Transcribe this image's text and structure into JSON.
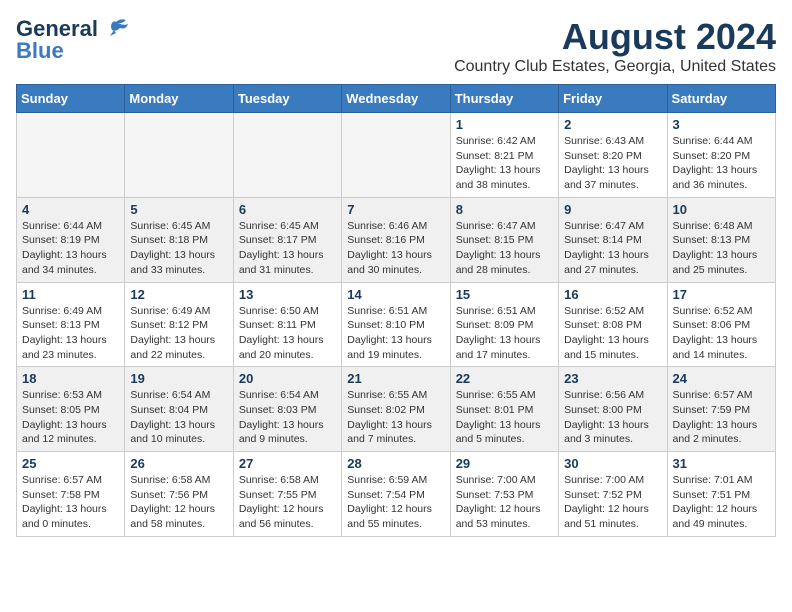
{
  "logo": {
    "line1": "General",
    "line2": "Blue"
  },
  "title": "August 2024",
  "subtitle": "Country Club Estates, Georgia, United States",
  "days_of_week": [
    "Sunday",
    "Monday",
    "Tuesday",
    "Wednesday",
    "Thursday",
    "Friday",
    "Saturday"
  ],
  "weeks": [
    [
      {
        "day": "",
        "info": ""
      },
      {
        "day": "",
        "info": ""
      },
      {
        "day": "",
        "info": ""
      },
      {
        "day": "",
        "info": ""
      },
      {
        "day": "1",
        "info": "Sunrise: 6:42 AM\nSunset: 8:21 PM\nDaylight: 13 hours\nand 38 minutes."
      },
      {
        "day": "2",
        "info": "Sunrise: 6:43 AM\nSunset: 8:20 PM\nDaylight: 13 hours\nand 37 minutes."
      },
      {
        "day": "3",
        "info": "Sunrise: 6:44 AM\nSunset: 8:20 PM\nDaylight: 13 hours\nand 36 minutes."
      }
    ],
    [
      {
        "day": "4",
        "info": "Sunrise: 6:44 AM\nSunset: 8:19 PM\nDaylight: 13 hours\nand 34 minutes."
      },
      {
        "day": "5",
        "info": "Sunrise: 6:45 AM\nSunset: 8:18 PM\nDaylight: 13 hours\nand 33 minutes."
      },
      {
        "day": "6",
        "info": "Sunrise: 6:45 AM\nSunset: 8:17 PM\nDaylight: 13 hours\nand 31 minutes."
      },
      {
        "day": "7",
        "info": "Sunrise: 6:46 AM\nSunset: 8:16 PM\nDaylight: 13 hours\nand 30 minutes."
      },
      {
        "day": "8",
        "info": "Sunrise: 6:47 AM\nSunset: 8:15 PM\nDaylight: 13 hours\nand 28 minutes."
      },
      {
        "day": "9",
        "info": "Sunrise: 6:47 AM\nSunset: 8:14 PM\nDaylight: 13 hours\nand 27 minutes."
      },
      {
        "day": "10",
        "info": "Sunrise: 6:48 AM\nSunset: 8:13 PM\nDaylight: 13 hours\nand 25 minutes."
      }
    ],
    [
      {
        "day": "11",
        "info": "Sunrise: 6:49 AM\nSunset: 8:13 PM\nDaylight: 13 hours\nand 23 minutes."
      },
      {
        "day": "12",
        "info": "Sunrise: 6:49 AM\nSunset: 8:12 PM\nDaylight: 13 hours\nand 22 minutes."
      },
      {
        "day": "13",
        "info": "Sunrise: 6:50 AM\nSunset: 8:11 PM\nDaylight: 13 hours\nand 20 minutes."
      },
      {
        "day": "14",
        "info": "Sunrise: 6:51 AM\nSunset: 8:10 PM\nDaylight: 13 hours\nand 19 minutes."
      },
      {
        "day": "15",
        "info": "Sunrise: 6:51 AM\nSunset: 8:09 PM\nDaylight: 13 hours\nand 17 minutes."
      },
      {
        "day": "16",
        "info": "Sunrise: 6:52 AM\nSunset: 8:08 PM\nDaylight: 13 hours\nand 15 minutes."
      },
      {
        "day": "17",
        "info": "Sunrise: 6:52 AM\nSunset: 8:06 PM\nDaylight: 13 hours\nand 14 minutes."
      }
    ],
    [
      {
        "day": "18",
        "info": "Sunrise: 6:53 AM\nSunset: 8:05 PM\nDaylight: 13 hours\nand 12 minutes."
      },
      {
        "day": "19",
        "info": "Sunrise: 6:54 AM\nSunset: 8:04 PM\nDaylight: 13 hours\nand 10 minutes."
      },
      {
        "day": "20",
        "info": "Sunrise: 6:54 AM\nSunset: 8:03 PM\nDaylight: 13 hours\nand 9 minutes."
      },
      {
        "day": "21",
        "info": "Sunrise: 6:55 AM\nSunset: 8:02 PM\nDaylight: 13 hours\nand 7 minutes."
      },
      {
        "day": "22",
        "info": "Sunrise: 6:55 AM\nSunset: 8:01 PM\nDaylight: 13 hours\nand 5 minutes."
      },
      {
        "day": "23",
        "info": "Sunrise: 6:56 AM\nSunset: 8:00 PM\nDaylight: 13 hours\nand 3 minutes."
      },
      {
        "day": "24",
        "info": "Sunrise: 6:57 AM\nSunset: 7:59 PM\nDaylight: 13 hours\nand 2 minutes."
      }
    ],
    [
      {
        "day": "25",
        "info": "Sunrise: 6:57 AM\nSunset: 7:58 PM\nDaylight: 13 hours\nand 0 minutes."
      },
      {
        "day": "26",
        "info": "Sunrise: 6:58 AM\nSunset: 7:56 PM\nDaylight: 12 hours\nand 58 minutes."
      },
      {
        "day": "27",
        "info": "Sunrise: 6:58 AM\nSunset: 7:55 PM\nDaylight: 12 hours\nand 56 minutes."
      },
      {
        "day": "28",
        "info": "Sunrise: 6:59 AM\nSunset: 7:54 PM\nDaylight: 12 hours\nand 55 minutes."
      },
      {
        "day": "29",
        "info": "Sunrise: 7:00 AM\nSunset: 7:53 PM\nDaylight: 12 hours\nand 53 minutes."
      },
      {
        "day": "30",
        "info": "Sunrise: 7:00 AM\nSunset: 7:52 PM\nDaylight: 12 hours\nand 51 minutes."
      },
      {
        "day": "31",
        "info": "Sunrise: 7:01 AM\nSunset: 7:51 PM\nDaylight: 12 hours\nand 49 minutes."
      }
    ]
  ]
}
